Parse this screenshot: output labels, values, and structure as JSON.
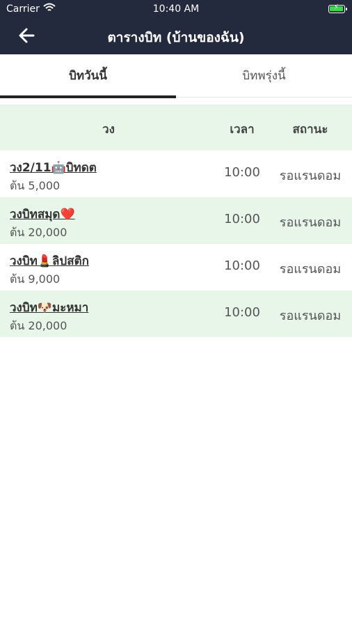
{
  "status_bar": {
    "carrier": "Carrier",
    "time": "10:40 AM"
  },
  "nav": {
    "title": "ตารางบิท (บ้านของฉัน)"
  },
  "tabs": [
    {
      "label": "บิทวันนี้",
      "active": true
    },
    {
      "label": "บิทพรุ่งนี้",
      "active": false
    }
  ],
  "table": {
    "headers": {
      "group": "วง",
      "time": "เวลา",
      "status": "สถานะ"
    },
    "rows": [
      {
        "name": "วง2/11🤖บิทดต",
        "amount": "ต้น 5,000",
        "time": "10:00",
        "status": "รอแรนดอม"
      },
      {
        "name": "วงบิทสมุด❤️",
        "amount": "ต้น 20,000",
        "time": "10:00",
        "status": "รอแรนดอม"
      },
      {
        "name": "วงบิท💄ลิปสติก",
        "amount": "ต้น 9,000",
        "time": "10:00",
        "status": "รอแรนดอม"
      },
      {
        "name": "วงบิท🐶มะหมา",
        "amount": "ต้น 20,000",
        "time": "10:00",
        "status": "รอแรนดอม"
      }
    ]
  },
  "colors": {
    "header_bg": "#242a3e",
    "row_alt": "#e8f6ea"
  }
}
